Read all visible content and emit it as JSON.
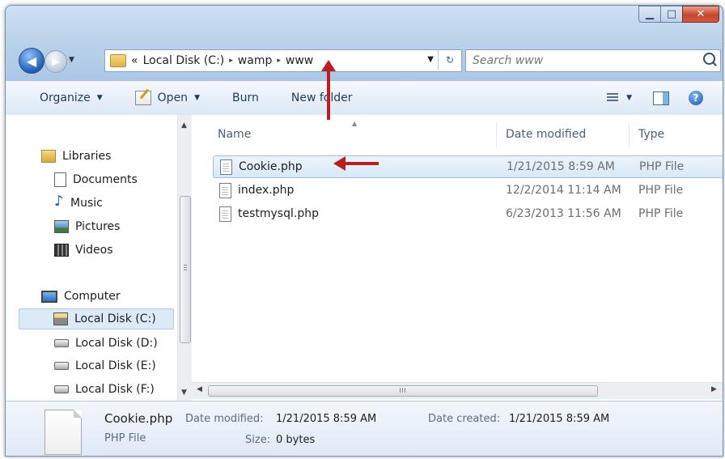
{
  "window": {
    "caption": {
      "min": "▁",
      "max": "□",
      "close": "✕"
    }
  },
  "address": {
    "overflow": "«",
    "crumbs": [
      "Local Disk (C:)",
      "wamp",
      "www"
    ],
    "separator": "▸",
    "refresh": "↻"
  },
  "search": {
    "placeholder": "Search www"
  },
  "toolbar": {
    "organize": "Organize",
    "open": "Open",
    "burn": "Burn",
    "new_folder": "New folder",
    "help": "?"
  },
  "nav": {
    "libraries": "Libraries",
    "documents": "Documents",
    "music": "Music",
    "pictures": "Pictures",
    "videos": "Videos",
    "computer": "Computer",
    "disk_c": "Local Disk (C:)",
    "disk_d": "Local Disk (D:)",
    "disk_e": "Local Disk (E:)",
    "disk_f": "Local Disk (F:)"
  },
  "columns": {
    "name": "Name",
    "date": "Date modified",
    "type": "Type"
  },
  "files": [
    {
      "name": "Cookie.php",
      "date": "1/21/2015 8:59 AM",
      "type": "PHP File"
    },
    {
      "name": "index.php",
      "date": "12/2/2014 11:14 AM",
      "type": "PHP File"
    },
    {
      "name": "testmysql.php",
      "date": "6/23/2013 11:56 AM",
      "type": "PHP File"
    }
  ],
  "details": {
    "name": "Cookie.php",
    "type": "PHP File",
    "modified_label": "Date modified:",
    "modified_value": "1/21/2015 8:59 AM",
    "size_label": "Size:",
    "size_value": "0 bytes",
    "created_label": "Date created:",
    "created_value": "1/21/2015 8:59 AM"
  },
  "colors": {
    "annotation_arrow": "#b81f1f",
    "selection": "#d8e8f8"
  }
}
